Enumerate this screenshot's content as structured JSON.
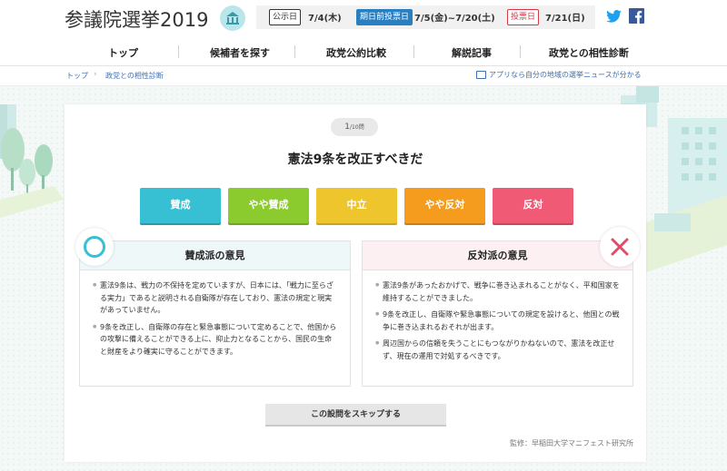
{
  "header": {
    "site_title": "参議院選挙2019",
    "dates": [
      {
        "label": "公示日",
        "value": "7/4(木)",
        "style": "outline"
      },
      {
        "label": "期日前投票日",
        "value": "7/5(金)~7/20(土)",
        "style": "blue"
      },
      {
        "label": "投票日",
        "value": "7/21(日)",
        "style": "red"
      }
    ],
    "social": [
      "twitter-icon",
      "facebook-icon"
    ]
  },
  "nav": {
    "items": [
      "トップ",
      "候補者を探す",
      "政党公約比較",
      "解説記事",
      "政党との相性診断"
    ]
  },
  "breadcrumb": {
    "items": [
      "トップ",
      "政党との相性診断"
    ],
    "app_link": "アプリなら自分の地域の選挙ニュースが分かる"
  },
  "quiz": {
    "progress_current": "1",
    "progress_total": "/10問",
    "question": "憲法9条を改正すべきだ",
    "answers": [
      "賛成",
      "やや賛成",
      "中立",
      "やや反対",
      "反対"
    ],
    "pro": {
      "title": "賛成派の意見",
      "points": [
        "憲法9条は、戦力の不保持を定めていますが、日本には、「戦力に至らざる実力」であると説明される自衛隊が存在しており、憲法の規定と現実があっていません。",
        "9条を改正し、自衛隊の存在と緊急事態について定めることで、他国からの攻撃に備えることができる上に、抑止力となることから、国民の生命と財産をより確実に守ることができます。"
      ]
    },
    "con": {
      "title": "反対派の意見",
      "points": [
        "憲法9条があったおかげで、戦争に巻き込まれることがなく、平和国家を維持することができました。",
        "9条を改正し、自衛隊や緊急事態についての規定を設けると、他国との戦争に巻き込まれるおそれが出ます。",
        "周辺国からの信頼を失うことにもつながりかねないので、憲法を改正せず、現在の運用で対処するべきです。"
      ]
    },
    "skip_label": "この設問をスキップする",
    "supervision": "監修：早稲田大学マニフェスト研究所"
  },
  "colors": {
    "agree": "#37c0d3",
    "slight_agree": "#8ccb2e",
    "neutral": "#efc52d",
    "slight_oppose": "#f59c1e",
    "oppose": "#f05a75"
  }
}
